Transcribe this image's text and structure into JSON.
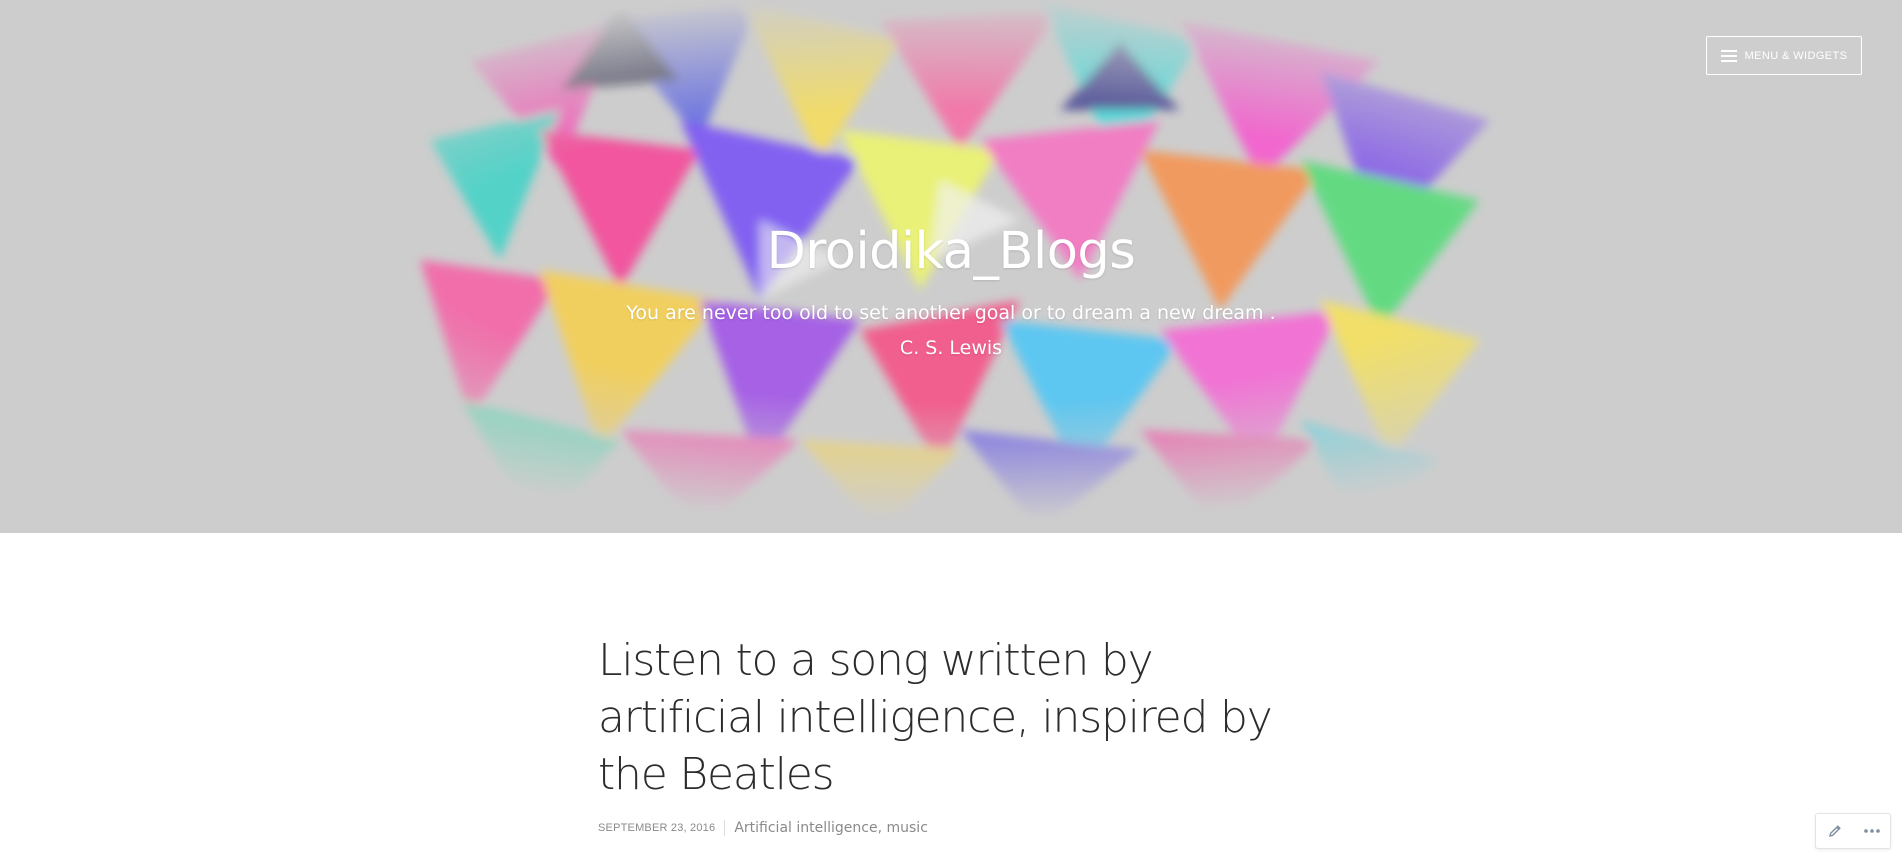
{
  "header": {
    "site_title": "Droidika_Blogs",
    "tagline": "You are never too old to set another goal or to dream a new dream . C. S. Lewis",
    "menu_label": "MENU & WIDGETS",
    "menu_icon": "hamburger-menu-icon"
  },
  "post": {
    "title": "Listen to a song written by artificial intelligence, inspired by the Beatles",
    "date": "SEPTEMBER 23, 2016",
    "categories": [
      "Artificial intelligence",
      "music"
    ]
  },
  "action_bar": {
    "edit_icon": "pencil-icon",
    "more_icon": "ellipsis-icon"
  },
  "colors": {
    "header_bg": "#cfcfcf",
    "title_text": "#ffffff",
    "post_title": "#2c2c2c",
    "meta_text": "#8a8a8a"
  }
}
